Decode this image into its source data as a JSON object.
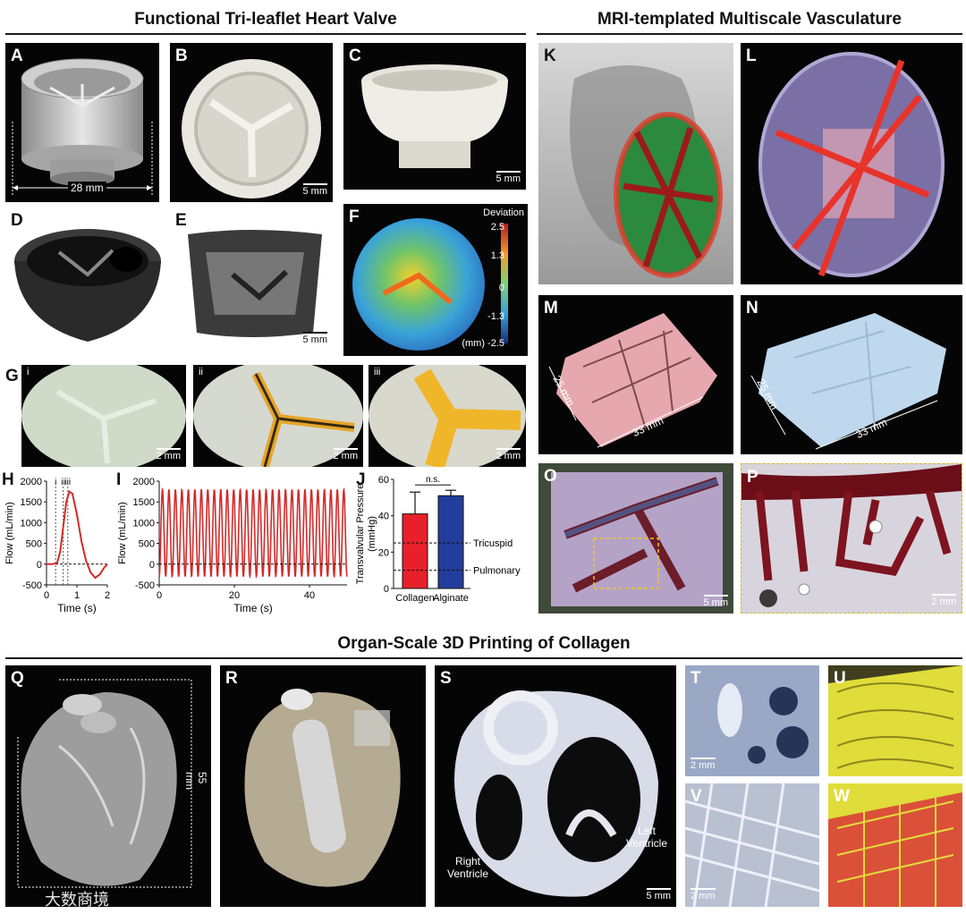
{
  "sections": {
    "valve": "Functional Tri-leaflet Heart Valve",
    "vasc": "MRI-templated Multiscale Vasculature",
    "organ": "Organ-Scale 3D Printing of Collagen"
  },
  "labels": {
    "A": "A",
    "B": "B",
    "C": "C",
    "D": "D",
    "E": "E",
    "F": "F",
    "G": "G",
    "H": "H",
    "I": "I",
    "J": "J",
    "K": "K",
    "L": "L",
    "M": "M",
    "N": "N",
    "O": "O",
    "P": "P",
    "Q": "Q",
    "R": "R",
    "S": "S",
    "T": "T",
    "U": "U",
    "V": "V",
    "W": "W"
  },
  "g_subs": [
    "i",
    "ii",
    "iii"
  ],
  "scales": {
    "five_mm": "5 mm",
    "two_mm": "2 mm"
  },
  "dims": {
    "a_width": "28 mm",
    "m_h": "25 mm",
    "m_w": "33 mm",
    "n_h": "25 mm",
    "n_w": "33 mm",
    "q_h": "55 mm"
  },
  "f_colorbar": {
    "title": "Deviation",
    "ticks": [
      "2.5",
      "1.3",
      "0",
      "-1.3",
      "(mm) -2.5"
    ]
  },
  "s_annotations": {
    "right": "Right\nVentricle",
    "left": "Left\nVentricle"
  },
  "watermark": "大数商境",
  "colors": {
    "line_red": "#d42a2a",
    "bar_red": "#e8202a",
    "bar_blue": "#233d9c",
    "valve_dark": "#050505"
  },
  "chart_data": [
    {
      "type": "line",
      "panel": "H",
      "xlabel": "Time (s)",
      "ylabel": "Flow (mL/min)",
      "xlim": [
        0,
        2
      ],
      "ylim": [
        -500,
        2000
      ],
      "xticks": [
        "0",
        "1",
        "2"
      ],
      "yticks": [
        "2000",
        "1500",
        "1000",
        "500",
        "0",
        "-500"
      ],
      "markers": [
        "i",
        "ii",
        "iii"
      ],
      "series": [
        {
          "x": [
            0,
            0.2,
            0.35,
            0.45,
            0.55,
            0.65,
            0.75,
            0.85,
            1.0,
            1.15,
            1.3,
            1.45,
            1.6,
            1.75,
            1.9,
            2.0
          ],
          "y": [
            0,
            0,
            30,
            300,
            900,
            1500,
            1750,
            1700,
            1200,
            550,
            80,
            -200,
            -330,
            -250,
            -80,
            0
          ]
        }
      ]
    },
    {
      "type": "line",
      "panel": "I",
      "xlabel": "Time (s)",
      "ylabel": "Flow (mL/min)",
      "xlim": [
        0,
        50
      ],
      "ylim": [
        -500,
        2000
      ],
      "xticks": [
        "0",
        "20",
        "40"
      ],
      "yticks": [
        "2000",
        "1500",
        "1000",
        "500",
        "0",
        "-500"
      ],
      "cycles": 29,
      "peak": 1800,
      "trough": -300
    },
    {
      "type": "bar",
      "panel": "J",
      "categories": [
        "Collagen",
        "Alginate"
      ],
      "values": [
        41,
        51
      ],
      "errors": [
        12,
        3
      ],
      "ylabel": "Transvalvular Pressure\n(mmHg)",
      "ylim": [
        0,
        60
      ],
      "yticks": [
        "60",
        "40",
        "20",
        "0"
      ],
      "reference_lines": [
        {
          "label": "Tricuspid",
          "value": 25
        },
        {
          "label": "Pulmonary",
          "value": 10
        }
      ],
      "significance": "n.s."
    }
  ]
}
